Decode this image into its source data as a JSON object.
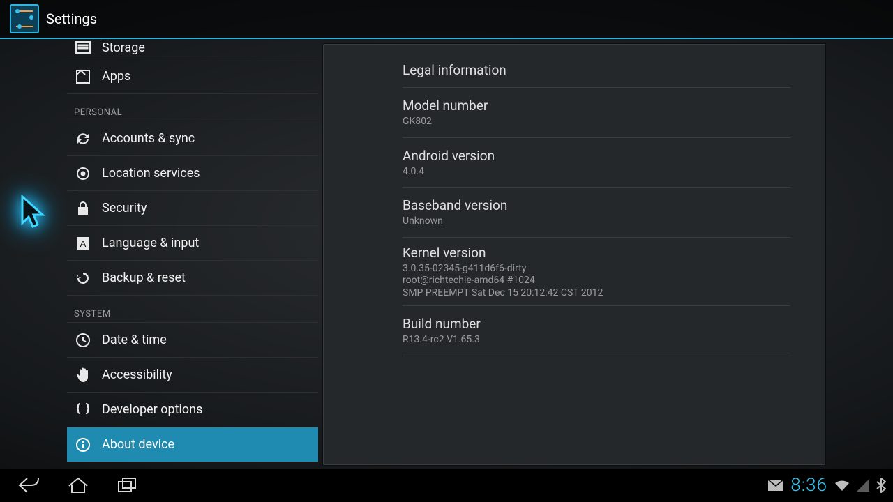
{
  "header": {
    "title": "Settings"
  },
  "sidebar": {
    "top": [
      {
        "icon": "storage",
        "label": "Storage"
      },
      {
        "icon": "apps",
        "label": "Apps"
      }
    ],
    "personal_header": "PERSONAL",
    "personal": [
      {
        "icon": "sync",
        "label": "Accounts & sync"
      },
      {
        "icon": "location",
        "label": "Location services"
      },
      {
        "icon": "lock",
        "label": "Security"
      },
      {
        "icon": "language",
        "label": "Language & input"
      },
      {
        "icon": "backup",
        "label": "Backup & reset"
      }
    ],
    "system_header": "SYSTEM",
    "system": [
      {
        "icon": "clock",
        "label": "Date & time"
      },
      {
        "icon": "hand",
        "label": "Accessibility"
      },
      {
        "icon": "braces",
        "label": "Developer options"
      },
      {
        "icon": "info",
        "label": "About device",
        "selected": true
      }
    ]
  },
  "pane": {
    "items": [
      {
        "title": "Legal information",
        "value": null
      },
      {
        "title": "Model number",
        "value": "GK802"
      },
      {
        "title": "Android version",
        "value": "4.0.4"
      },
      {
        "title": "Baseband version",
        "value": "Unknown"
      },
      {
        "title": "Kernel version",
        "value": "3.0.35-02345-g411d6f6-dirty\nroot@richtechie-amd64 #1024\nSMP PREEMPT Sat Dec 15 20:12:42 CST 2012"
      },
      {
        "title": "Build number",
        "value": "R13.4-rc2 V1.65.3"
      }
    ]
  },
  "navbar": {
    "clock": "8:36"
  }
}
